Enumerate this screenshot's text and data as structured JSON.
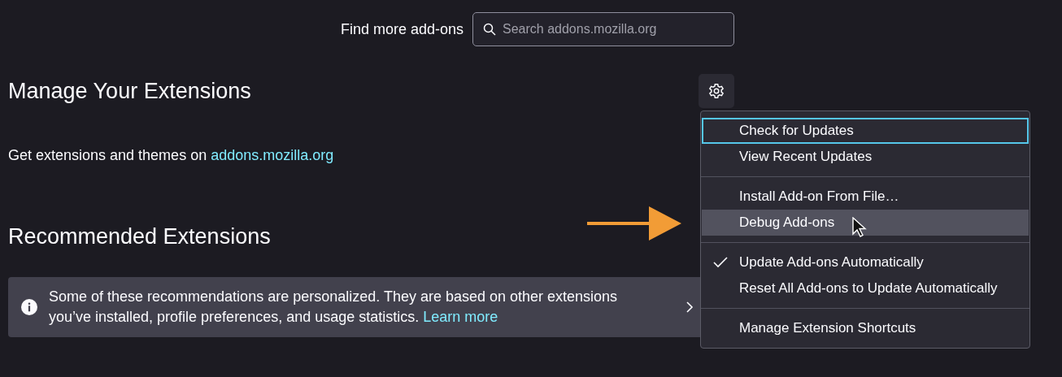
{
  "header": {
    "label": "Find more add-ons",
    "search": {
      "placeholder": "Search addons.mozilla.org"
    }
  },
  "manage": {
    "title": "Manage Your Extensions",
    "text": "Get extensions and themes on ",
    "link": "addons.mozilla.org"
  },
  "recommended": {
    "title": "Recommended Extensions",
    "notice": {
      "text": "Some of these recommendations are personalized. They are based on other extensions you’ve installed, profile preferences, and usage statistics.",
      "link": "Learn more"
    }
  },
  "menu": {
    "groups": [
      [
        {
          "label": "Check for Updates",
          "focused": true,
          "hovered": false,
          "checked": false
        },
        {
          "label": "View Recent Updates",
          "focused": false,
          "hovered": false,
          "checked": false
        }
      ],
      [
        {
          "label": "Install Add-on From File…",
          "focused": false,
          "hovered": false,
          "checked": false
        },
        {
          "label": "Debug Add-ons",
          "focused": false,
          "hovered": true,
          "checked": false
        }
      ],
      [
        {
          "label": "Update Add-ons Automatically",
          "focused": false,
          "hovered": false,
          "checked": true
        },
        {
          "label": "Reset All Add-ons to Update Automatically",
          "focused": false,
          "hovered": false,
          "checked": false
        }
      ],
      [
        {
          "label": "Manage Extension Shortcuts",
          "focused": false,
          "hovered": false,
          "checked": false
        }
      ]
    ]
  }
}
